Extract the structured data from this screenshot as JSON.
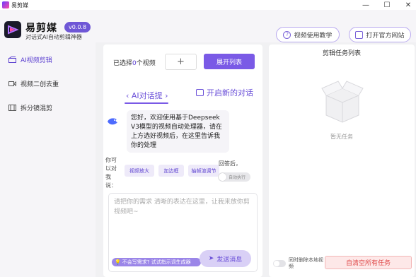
{
  "window": {
    "title": "易剪媒",
    "controls": [
      "—",
      "☐",
      "✕"
    ]
  },
  "header": {
    "brand": "易剪媒",
    "version": "v0.0.8",
    "tagline": "对话式AI自动剪辑神器",
    "tutorial_button": "视频使用教学",
    "website_button": "打开官方网站"
  },
  "sidebar": {
    "items": [
      {
        "label": "AI视频剪辑",
        "icon": "film-clip-icon",
        "active": true
      },
      {
        "label": "视频二创去重",
        "icon": "video-camera-icon",
        "active": false
      },
      {
        "label": "拆分镜混剪",
        "icon": "film-strip-icon",
        "active": false
      }
    ]
  },
  "video_bar": {
    "selected_prefix": "已选择",
    "selected_count": "0",
    "selected_suffix": "个视频",
    "add_label": "+",
    "expand_label": "展开列表"
  },
  "chat": {
    "tab_label": "‹ AI对话提 ›",
    "new_chat_label": "开启新的对话",
    "welcome_message": "您好，欢迎使用基于Deepseek V3模型的视频自动处理器，请在上方选好视频后，在这里告诉我你的处理",
    "ask_label": "你可以对我说：",
    "suggestions": [
      "视频放大",
      "加边框",
      "抽帧渲调节"
    ],
    "after_reply_label": "回答后，",
    "auto_run_label": "自动执行",
    "input_placeholder": "请把你的需求 清晰的表达在这里，让我来放你剪视频吧~",
    "hint_label": "不会写需求? 试试指示词生成器",
    "send_label": "发送消息"
  },
  "tasks": {
    "title": "剪辑任务列表",
    "empty_text": "暂无任务",
    "delete_local_label": "同时删除本地视频",
    "clear_button": "自清空所有任务"
  },
  "colors": {
    "accent": "#7a5ae6",
    "accent_text": "#5b3fd0",
    "danger": "#e04848"
  }
}
